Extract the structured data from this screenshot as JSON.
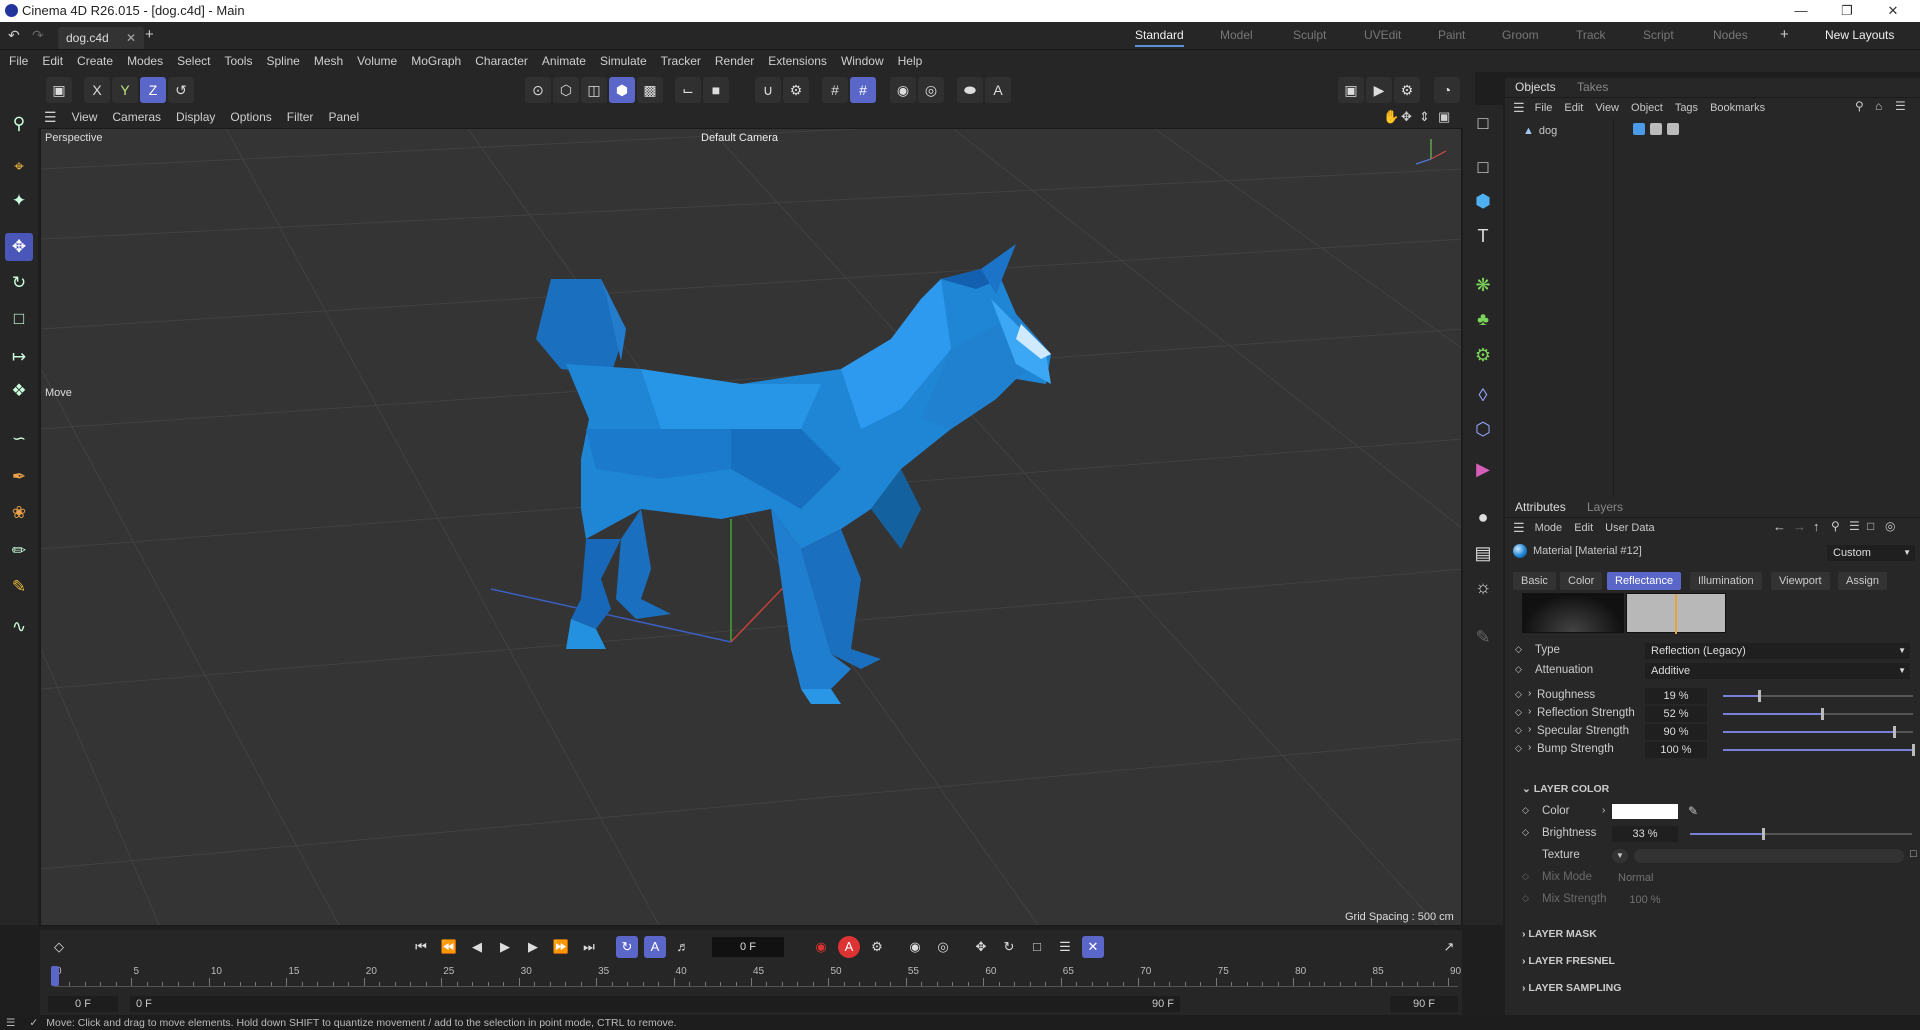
{
  "window": {
    "title": "Cinema 4D R26.015 - [dog.c4d] - Main"
  },
  "tabs": {
    "doc": "dog.c4d"
  },
  "layouts": [
    "Standard",
    "Model",
    "Sculpt",
    "UVEdit",
    "Paint",
    "Groom",
    "Track",
    "Script",
    "Nodes"
  ],
  "new_layouts": "New Layouts",
  "menu": [
    "File",
    "Edit",
    "Create",
    "Modes",
    "Select",
    "Tools",
    "Spline",
    "Mesh",
    "Volume",
    "MoGraph",
    "Character",
    "Animate",
    "Simulate",
    "Tracker",
    "Render",
    "Extensions",
    "Window",
    "Help"
  ],
  "viewport_menu": [
    "View",
    "Cameras",
    "Display",
    "Options",
    "Filter",
    "Panel"
  ],
  "viewport": {
    "mode": "Perspective",
    "camera": "Default Camera",
    "grid": "Grid Spacing : 500 cm",
    "tool": "Move"
  },
  "objects_panel": {
    "tabs": [
      "Objects",
      "Takes"
    ],
    "menu": [
      "File",
      "Edit",
      "View",
      "Object",
      "Tags",
      "Bookmarks"
    ],
    "object": "dog"
  },
  "attributes_panel": {
    "tabs": [
      "Attributes",
      "Layers"
    ],
    "menu": [
      "Mode",
      "Edit",
      "User Data"
    ],
    "material": "Material [Material #12]",
    "preset": "Custom",
    "mat_tabs": [
      "Basic",
      "Color",
      "Reflectance",
      "Illumination",
      "Viewport",
      "Assign"
    ],
    "type_label": "Type",
    "type_value": "Reflection (Legacy)",
    "atten_label": "Attenuation",
    "atten_value": "Additive",
    "params": [
      {
        "label": "Roughness",
        "value": "19 %",
        "pct": 0.19
      },
      {
        "label": "Reflection Strength",
        "value": "52 %",
        "pct": 0.52
      },
      {
        "label": "Specular Strength",
        "value": "90 %",
        "pct": 0.9
      },
      {
        "label": "Bump Strength",
        "value": "100 %",
        "pct": 1.0
      }
    ],
    "layer_color": "LAYER COLOR",
    "color_label": "Color",
    "brightness_label": "Brightness",
    "brightness_value": "33 %",
    "texture_label": "Texture",
    "mixmode_label": "Mix Mode",
    "mixmode_value": "Normal",
    "mixstrength_label": "Mix Strength",
    "mixstrength_value": "100 %",
    "sections": [
      "LAYER MASK",
      "LAYER FRESNEL",
      "LAYER SAMPLING"
    ]
  },
  "timeline": {
    "frame": "0 F",
    "ticks": [
      "0",
      "5",
      "10",
      "15",
      "20",
      "25",
      "30",
      "35",
      "40",
      "45",
      "50",
      "55",
      "60",
      "65",
      "70",
      "75",
      "80",
      "85",
      "90"
    ],
    "start": "0 F",
    "start2": "0 F",
    "end": "90 F",
    "end2": "90 F"
  },
  "status": "Move: Click and drag to move elements. Hold down SHIFT to quantize movement / add to the selection in point mode, CTRL to remove.",
  "colors": {
    "accent": "#5a66c8",
    "dog": "#1f86d6",
    "bg": "#262626"
  }
}
